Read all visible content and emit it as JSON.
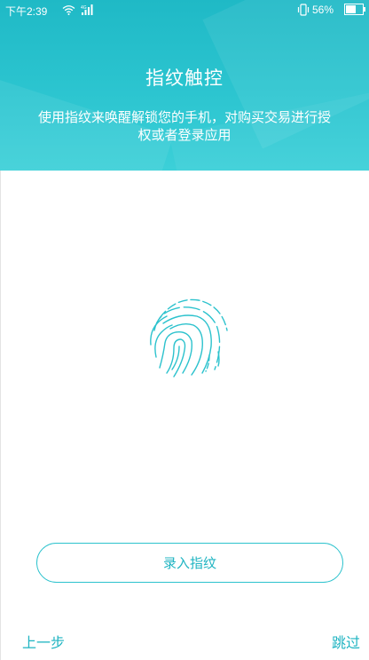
{
  "status_bar": {
    "time": "下午2:39",
    "battery": "56%",
    "icons": [
      "wifi-icon",
      "signal-icon",
      "vibrate-icon",
      "battery-icon"
    ]
  },
  "header": {
    "title": "指纹触控",
    "description": "使用指纹来唤醒解锁您的手机，对购买交易进行授权或者登录应用"
  },
  "main": {
    "fingerprint_icon": "fingerprint-icon",
    "enroll_button": "录入指纹"
  },
  "footer": {
    "prev_label": "上一步",
    "skip_label": "跳过"
  },
  "colors": {
    "accent": "#2cc2cd",
    "header_top": "#1fb9c6",
    "header_bottom": "#3cd0d8",
    "text_accent": "#1fb4c2"
  }
}
